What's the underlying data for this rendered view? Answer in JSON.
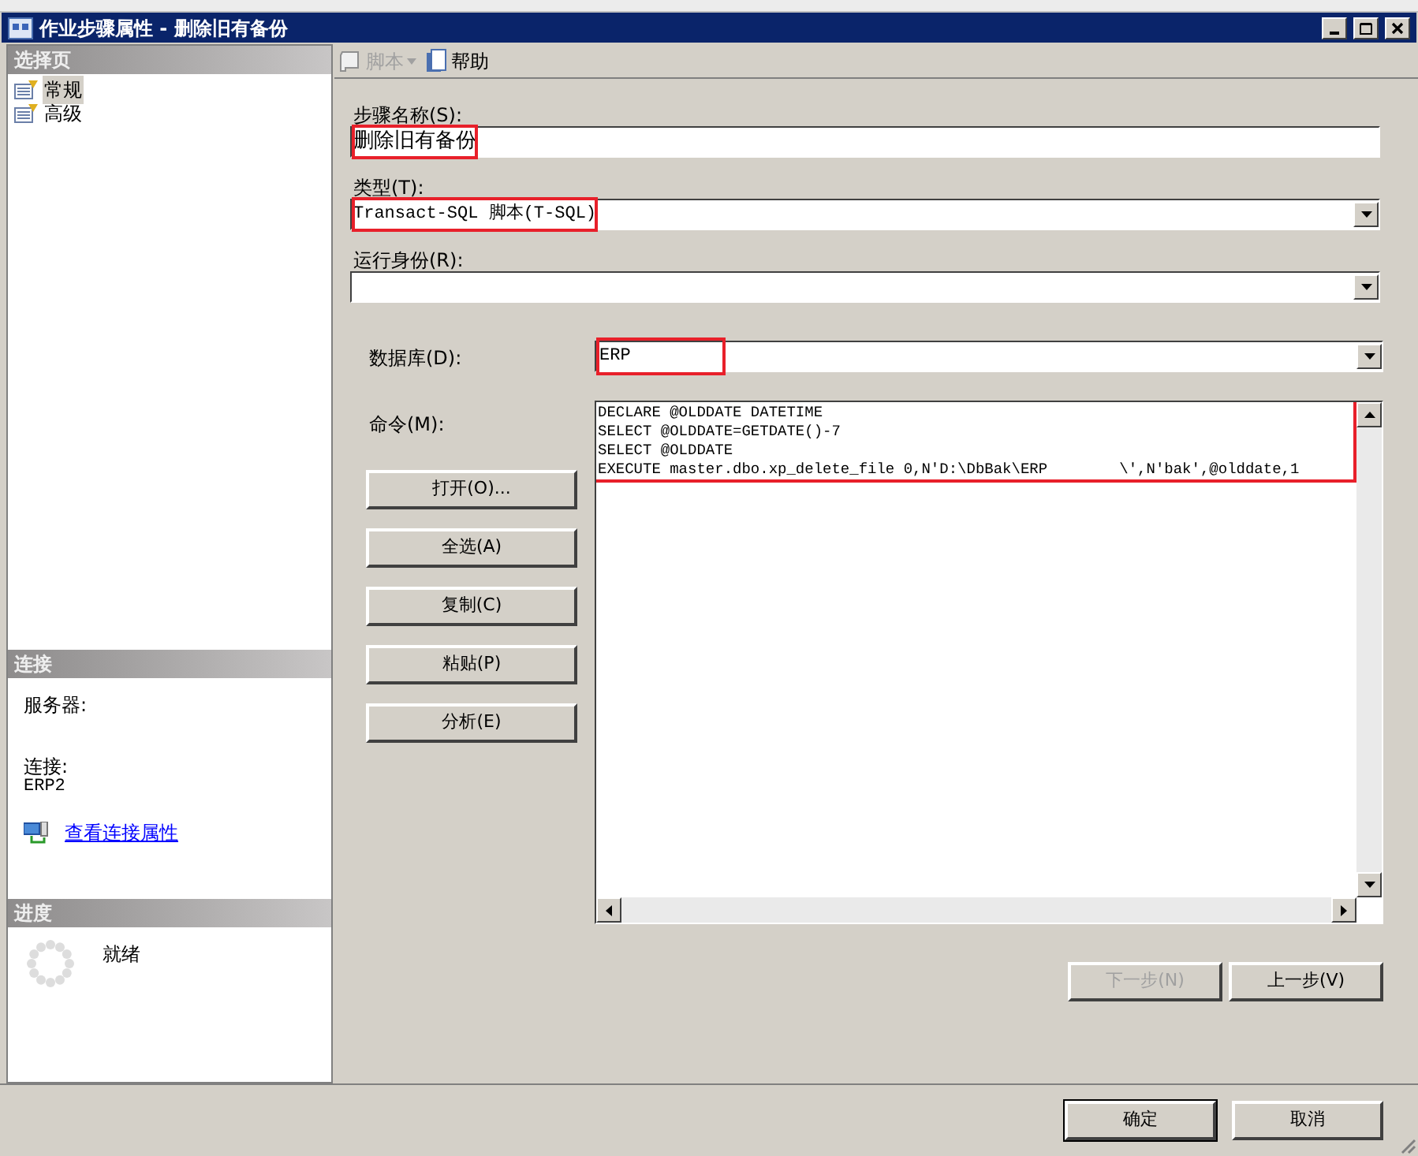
{
  "window": {
    "title": "作业步骤属性 - 删除旧有备份"
  },
  "sidebar": {
    "header": "选择页",
    "items": [
      {
        "label": "常规",
        "selected": true
      },
      {
        "label": "高级",
        "selected": false
      }
    ]
  },
  "connection": {
    "header": "连接",
    "server_label": "服务器:",
    "connection_label": "连接:",
    "connection_value": "ERP2",
    "link": "查看连接属性"
  },
  "progress": {
    "header": "进度",
    "status": "就绪"
  },
  "toolbar": [
    {
      "kind": "script",
      "label": "脚本",
      "disabled": true
    },
    {
      "kind": "help",
      "label": "帮助",
      "disabled": false
    }
  ],
  "fields": [
    {
      "kind": "text",
      "label": "步骤名称(S):",
      "value": "删除旧有备份",
      "highlighted": true
    },
    {
      "kind": "select",
      "label": "类型(T):",
      "value": "Transact-SQL 脚本(T-SQL)",
      "highlighted": true
    },
    {
      "kind": "select",
      "label": "运行身份(R):"
    }
  ],
  "database": {
    "label": "数据库(D):",
    "value": "ERP",
    "highlighted": true
  },
  "command": {
    "label": "命令(M):",
    "highlighted": true,
    "lines": [
      "DECLARE @OLDDATE DATETIME",
      "SELECT @OLDDATE=GETDATE()-7",
      "SELECT @OLDDATE",
      "EXECUTE master.dbo.xp_delete_file 0,N'D:\\DbBak\\ERP        \\',N'bak',@olddate,1"
    ]
  },
  "command_buttons": [
    "打开(O)...",
    "全选(A)",
    "复制(C)",
    "粘贴(P)",
    "分析(E)"
  ],
  "nav_buttons": [
    {
      "label": "下一步(N)",
      "disabled": true
    },
    {
      "label": "上一步(V)",
      "disabled": false
    }
  ],
  "dialog_buttons": [
    {
      "label": "确定",
      "default": true
    },
    {
      "label": "取消",
      "default": false
    }
  ]
}
